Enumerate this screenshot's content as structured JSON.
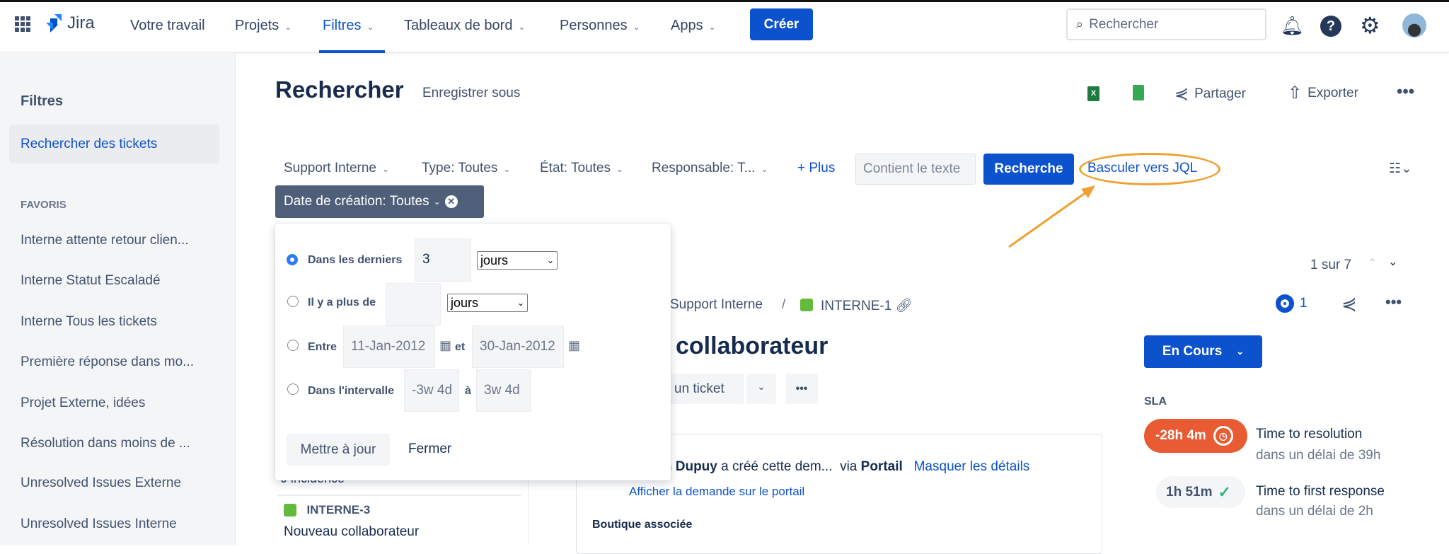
{
  "nav": {
    "product": "Jira",
    "items": [
      {
        "label": "Votre travail"
      },
      {
        "label": "Projets"
      },
      {
        "label": "Filtres",
        "active": true
      },
      {
        "label": "Tableaux de bord"
      },
      {
        "label": "Personnes"
      },
      {
        "label": "Apps"
      }
    ],
    "create": "Créer",
    "search_placeholder": "Rechercher"
  },
  "sidebar": {
    "title": "Filtres",
    "selected": "Rechercher des tickets",
    "section": "FAVORIS",
    "items": [
      "Interne attente retour clien...",
      "Interne Statut Escaladé",
      "Interne Tous les tickets",
      "Première réponse dans mo...",
      "Projet Externe, idées",
      "Résolution dans moins de ...",
      "Unresolved Issues Externe",
      "Unresolved Issues Interne"
    ]
  },
  "header": {
    "title": "Rechercher",
    "save_as": "Enregistrer sous",
    "share": "Partager",
    "export": "Exporter"
  },
  "filters": {
    "project": "Support Interne",
    "type": "Type: Toutes",
    "status": "État: Toutes",
    "assignee": "Responsable: T...",
    "more": "+ Plus",
    "text_placeholder": "Contient le texte",
    "search": "Recherche",
    "switch_jql": "Basculer vers JQL",
    "created_chip": "Date de création: Toutes"
  },
  "date_panel": {
    "row1": {
      "label": "Dans les derniers",
      "value": "3",
      "unit": "jours",
      "selected": true
    },
    "row2": {
      "label": "Il y a plus de",
      "value": "",
      "unit": "jours"
    },
    "row3": {
      "label": "Entre",
      "from": "11-Jan-2012",
      "and": "et",
      "to": "30-Jan-2012"
    },
    "row4": {
      "label": "Dans l'intervalle",
      "from": "-3w 4d",
      "to_label": "à",
      "to": "3w 4d"
    },
    "update": "Mettre à jour",
    "close": "Fermer"
  },
  "list": {
    "clipped": "J incidence",
    "items": [
      {
        "key": "INTERNE-3",
        "summary": "Nouveau collaborateur"
      }
    ]
  },
  "issue": {
    "pager": "1 sur 7",
    "breadcrumb_project": "Support Interne",
    "key": "INTERNE-1",
    "watchers": "1",
    "title": "collaborateur",
    "action": "un ticket",
    "creator_text": "em Dupuy",
    "created_text": "a créé cette dem...",
    "via": "via",
    "channel": "Portail",
    "hide_details": "Masquer les détails",
    "portal_link": "Afficher la demande sur le portail",
    "field_label": "Boutique associée",
    "status": "En Cours",
    "sla_title": "SLA",
    "sla": [
      {
        "value": "-28h 4m",
        "name": "Time to resolution",
        "goal": "dans un délai de 39h",
        "state": "breached",
        "color": "#e85b33"
      },
      {
        "value": "1h 51m",
        "name": "Time to first response",
        "goal": "dans un délai de 2h",
        "state": "met",
        "color": "#36b37e"
      }
    ]
  },
  "colors": {
    "accent": "#0c52cc",
    "annotation": "#f0a030"
  }
}
